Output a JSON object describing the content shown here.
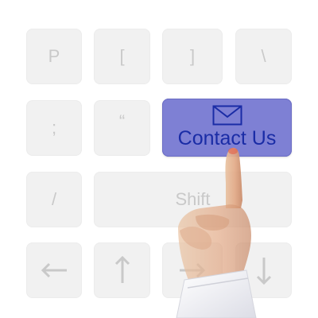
{
  "keys": {
    "p": "P",
    "bracket_open": "[",
    "bracket_close": "]",
    "backslash": "\\",
    "semicolon": ";",
    "quote": "“",
    "slash": "/",
    "shift": "Shift"
  },
  "contact_button": {
    "label": "Contact Us",
    "icon": "envelope-icon",
    "color": "#7e80d4",
    "text_color": "#1a2ca6"
  },
  "arrow_keys": {
    "left": "arrow-left-icon",
    "up": "arrow-up-icon",
    "right": "arrow-right-icon",
    "down": "arrow-down-icon"
  },
  "colors": {
    "key_background": "#f1f1f1",
    "key_text": "#c9c9c9"
  }
}
